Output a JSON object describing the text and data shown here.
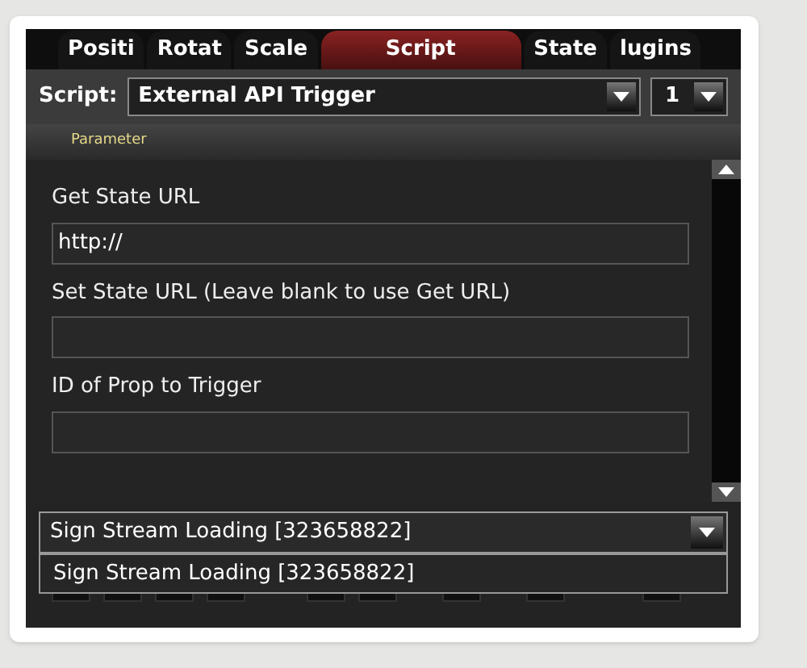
{
  "tabs": [
    {
      "label": "Positi",
      "selected": false
    },
    {
      "label": "Rotat",
      "selected": false
    },
    {
      "label": "Scale",
      "selected": false
    },
    {
      "label": "Script",
      "selected": true
    },
    {
      "label": "State",
      "selected": false
    },
    {
      "label": "lugins",
      "selected": false
    }
  ],
  "script": {
    "label": "Script:",
    "value": "External API Trigger",
    "index": "1"
  },
  "section_header": "Parameter",
  "fields": [
    {
      "label": "Get State URL",
      "value": "http://"
    },
    {
      "label": "Set State URL (Leave blank to use Get URL)"
    },
    {
      "label": "ID of Prop to Trigger"
    }
  ],
  "prop_dropdown": {
    "value": "Sign Stream Loading [323658822]",
    "expanded": true,
    "options": [
      {
        "label": "Sign Stream Loading [323658822]",
        "selected": true
      }
    ]
  }
}
